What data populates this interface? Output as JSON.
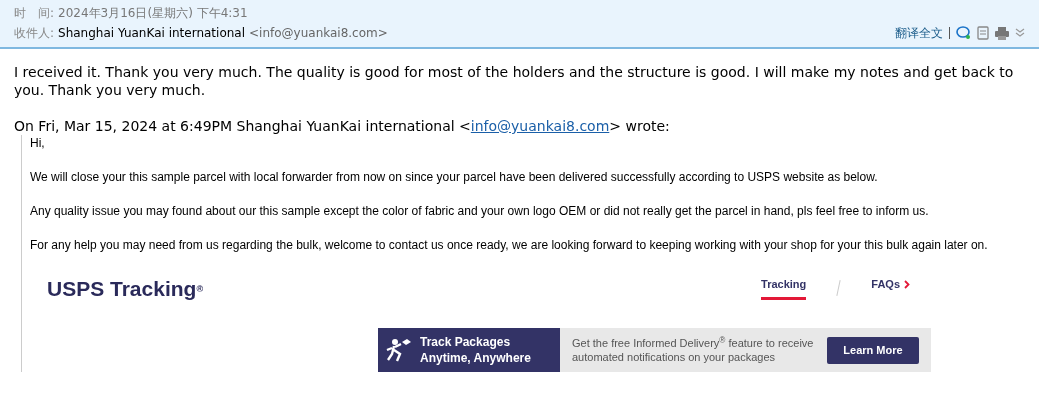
{
  "header": {
    "time_label": "时　间:",
    "time": "2024年3月16日(星期六) 下午4:31",
    "to_label": "收件人:",
    "to_name": "Shanghai YuanKai international",
    "to_email": "<info@yuankai8.com>",
    "translate": "翻译全文"
  },
  "body": {
    "paragraphs": [
      "I received it. Thank you very much. The quality is good for most of the holders and the structure is good. I will make my notes and get back to you. Thank you very much."
    ],
    "quote_intro_before": "On Fri, Mar 15, 2024 at 6:49PM Shanghai YuanKai international <",
    "quote_intro_link": "info@yuankai8.com",
    "quote_intro_after": "> wrote:"
  },
  "quote": {
    "paragraphs": [
      "Hi,",
      "We will close your this sample parcel with local forwarder from now on since your parcel have been delivered successfully according to USPS website as below.",
      "Any quality issue you may found about our this sample except the color of fabric and your own logo OEM or did not really get the parcel in hand, pls feel free to inform us.",
      "For any help you may need from us regarding the bulk, welcome to contact us once ready, we are looking forward to keeping working with your shop for your this bulk again later on."
    ]
  },
  "usps": {
    "logo": "USPS Tracking",
    "logo_mark": "®",
    "tabs": [
      {
        "label": "Tracking",
        "selected": true
      },
      {
        "label": "FAQs",
        "selected": false
      }
    ],
    "banner": {
      "title_lines": [
        "Track Packages",
        "Anytime, Anywhere"
      ],
      "text": "Get the free Informed Delivery$^{®}$ feature to receive automated notifications on your packages",
      "button": "Learn More"
    }
  }
}
